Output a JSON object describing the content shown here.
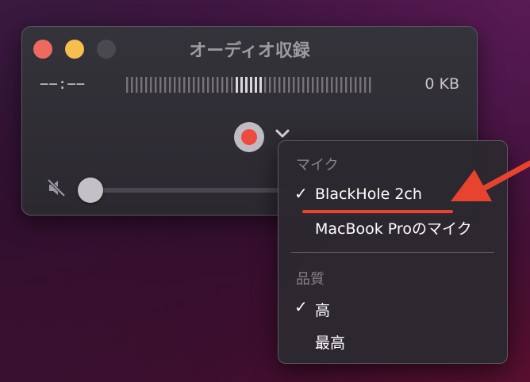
{
  "window": {
    "title": "オーディオ収録",
    "time": "−−:−−",
    "file_size": "0 KB"
  },
  "menu": {
    "mic_header": "マイク",
    "mic_items": [
      {
        "label": "BlackHole 2ch",
        "checked": true
      },
      {
        "label": "MacBook Proのマイク",
        "checked": false
      }
    ],
    "quality_header": "品質",
    "quality_items": [
      {
        "label": "高",
        "checked": true
      },
      {
        "label": "最高",
        "checked": false
      }
    ],
    "checkmark": "✓"
  },
  "colors": {
    "record": "#ee4b40",
    "annotation": "#e8432f",
    "close": "#ed6a5e",
    "minimize": "#f5bf4f"
  },
  "icons": [
    "close-icon",
    "minimize-icon",
    "maximize-icon",
    "record-icon",
    "chevron-down-icon",
    "mute-icon",
    "checkmark-icon",
    "arrow-icon"
  ]
}
